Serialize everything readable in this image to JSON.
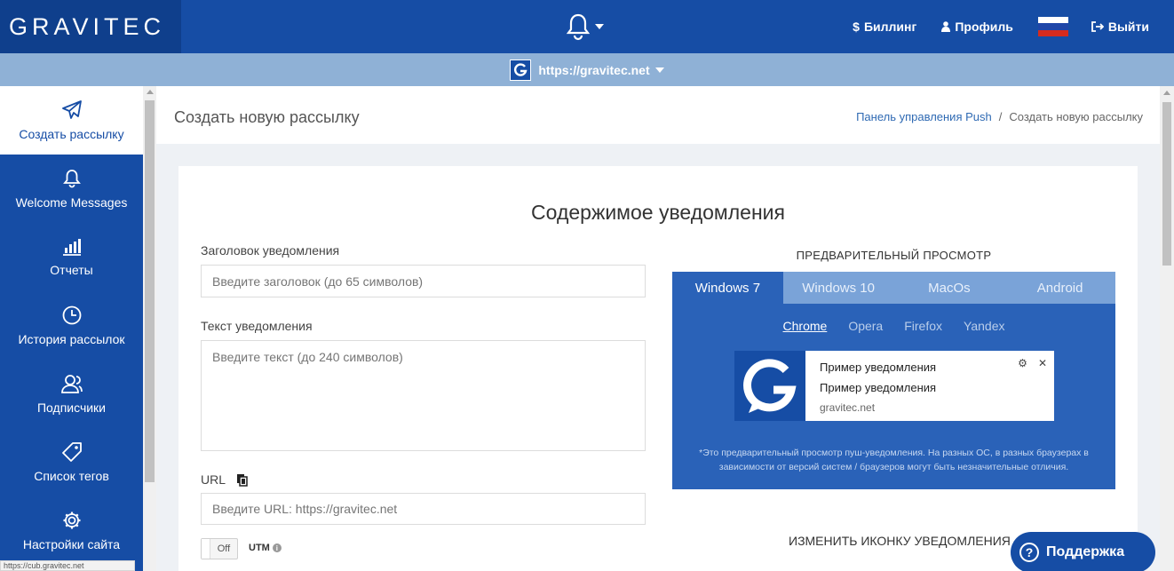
{
  "brand": {
    "logo_text": "GRAVITEC"
  },
  "topnav": {
    "billing": "Биллинг",
    "profile": "Профиль",
    "logout": "Выйти",
    "flag_colors": [
      "#ffffff",
      "#1f46a8",
      "#d52b1e"
    ]
  },
  "site": {
    "url": "https://gravitec.net"
  },
  "sidebar": {
    "items": [
      {
        "label": "Создать рассылку",
        "icon": "paper-plane-icon"
      },
      {
        "label": "Welcome Messages",
        "icon": "bell-icon"
      },
      {
        "label": "Отчеты",
        "icon": "bar-chart-icon"
      },
      {
        "label": "История рассылок",
        "icon": "clock-icon"
      },
      {
        "label": "Подписчики",
        "icon": "users-icon"
      },
      {
        "label": "Список тегов",
        "icon": "tag-icon"
      },
      {
        "label": "Настройки сайта",
        "icon": "gear-icon"
      }
    ]
  },
  "header": {
    "title": "Создать новую рассылку",
    "breadcrumb": {
      "home": "Панель управления Push",
      "separator": "/",
      "current": "Создать новую рассылку"
    }
  },
  "form": {
    "section_title": "Содержимое уведомления",
    "title_label": "Заголовок уведомления",
    "title_placeholder": "Введите заголовок (до 65 символов)",
    "text_label": "Текст уведомления",
    "text_placeholder": "Введите текст (до 240 символов)",
    "url_label": "URL",
    "url_placeholder": "Введите URL: https://gravitec.net",
    "toggle_label": "Off",
    "utm_label": "UTM"
  },
  "preview": {
    "title": "ПРЕДВАРИТЕЛЬНЫЙ ПРОСМОТР",
    "os_tabs": [
      "Windows 7",
      "Windows 10",
      "MacOs",
      "Android"
    ],
    "browser_tabs": [
      "Chrome",
      "Opera",
      "Firefox",
      "Yandex"
    ],
    "notification": {
      "title": "Пример уведомления",
      "body": "Пример уведомления",
      "domain": "gravitec.net"
    },
    "note": "*Это предварительный просмотр пуш-уведомления. На разных ОС, в разных браузерах в зависимости от версий систем / браузеров могут быть незначительные отличия."
  },
  "change_icon": {
    "label": "ИЗМЕНИТЬ ИКОНКУ УВЕДОМЛЕНИЯ"
  },
  "support": {
    "label": "Поддержка"
  },
  "status_bar": {
    "url": "https://cub.gravitec.net"
  }
}
